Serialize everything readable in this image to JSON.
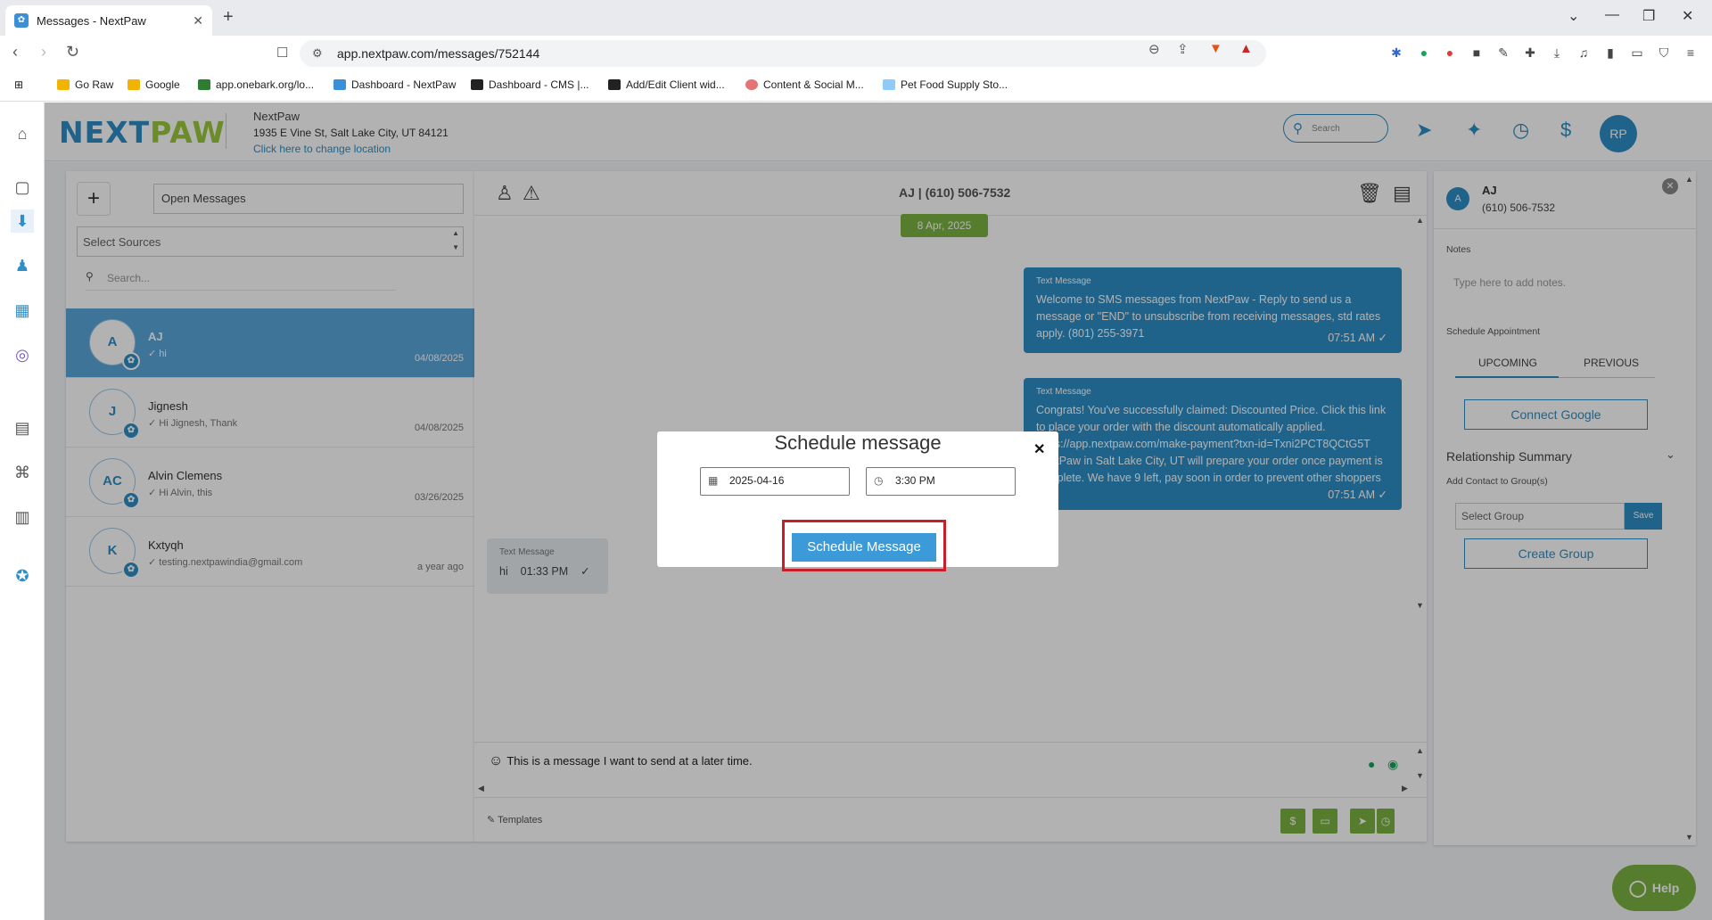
{
  "browser": {
    "tab_title": "Messages - NextPaw",
    "url": "app.nextpaw.com/messages/752144",
    "bookmarks": [
      "Go Raw",
      "Google",
      "app.onebark.org/lo...",
      "Dashboard - NextPaw",
      "Dashboard - CMS |...",
      "Add/Edit Client wid...",
      "Content & Social M...",
      "Pet Food Supply Sto..."
    ]
  },
  "header": {
    "logo_left": "NEXT",
    "logo_right": "PAW",
    "location_name": "NextPaw",
    "location_address": "1935 E Vine St, Salt Lake City, UT 84121",
    "change_location": "Click here to change location",
    "search_placeholder": "Search",
    "user_initials": "RP"
  },
  "left": {
    "filter_value": "Open Messages",
    "sources_placeholder": "Select Sources",
    "search_placeholder": "Search...",
    "conversations": [
      {
        "initials": "A",
        "name": "AJ",
        "preview": "✓ hi",
        "date": "04/08/2025"
      },
      {
        "initials": "J",
        "name": "Jignesh",
        "preview": "✓ Hi Jignesh, Thank",
        "date": "04/08/2025"
      },
      {
        "initials": "AC",
        "name": "Alvin Clemens",
        "preview": "✓ Hi Alvin, this",
        "date": "03/26/2025"
      },
      {
        "initials": "K",
        "name": "Kxtyqh",
        "preview": "✓ testing.nextpawindia@gmail.com",
        "date": "a year ago"
      }
    ]
  },
  "chat": {
    "title": "AJ | (610) 506-7532",
    "date_chip": "8 Apr, 2025",
    "messages": [
      {
        "label": "Text Message",
        "body": "Welcome to SMS messages from NextPaw - Reply to send us a message or \"END\" to unsubscribe from receiving messages, std rates apply. (801) 255-3971",
        "time": "07:51 AM ✓"
      },
      {
        "label": "Text Message",
        "body": "Congrats! You've successfully claimed: Discounted Price. Click this link to place your order with the discount automatically applied. https://app.nextpaw.com/make-payment?txn-id=Txni2PCT8QCtG5T NextPaw in Salt Lake City, UT will prepare your order once payment is complete. We have 9 left, pay soon in order to prevent other shoppers from purchasing before you.",
        "time": "07:51 AM ✓"
      }
    ],
    "incoming": {
      "label": "Text Message",
      "body": "hi",
      "time": "01:33 PM",
      "check": "✓"
    },
    "composer_text": "This is a message I want to send at a later time.",
    "templates_label": "Templates"
  },
  "right": {
    "initial": "A",
    "name": "AJ",
    "phone": "(610) 506-7532",
    "notes_label": "Notes",
    "notes_placeholder": "Type here to add notes.",
    "schedule_label": "Schedule Appointment",
    "tab_upcoming": "UPCOMING",
    "tab_previous": "PREVIOUS",
    "connect_google": "Connect Google",
    "relationship_summary": "Relationship Summary",
    "add_contact": "Add Contact to Group(s)",
    "select_group": "Select Group",
    "save": "Save",
    "create_group": "Create Group"
  },
  "help_label": "Help",
  "modal": {
    "title": "Schedule message",
    "date_value": "2025-04-16",
    "time_value": "3:30 PM",
    "button_label": "Schedule Message"
  },
  "colors": {
    "brand_blue": "#2f8fc6",
    "brand_green": "#7cb342",
    "highlight_red": "#c81e28"
  }
}
